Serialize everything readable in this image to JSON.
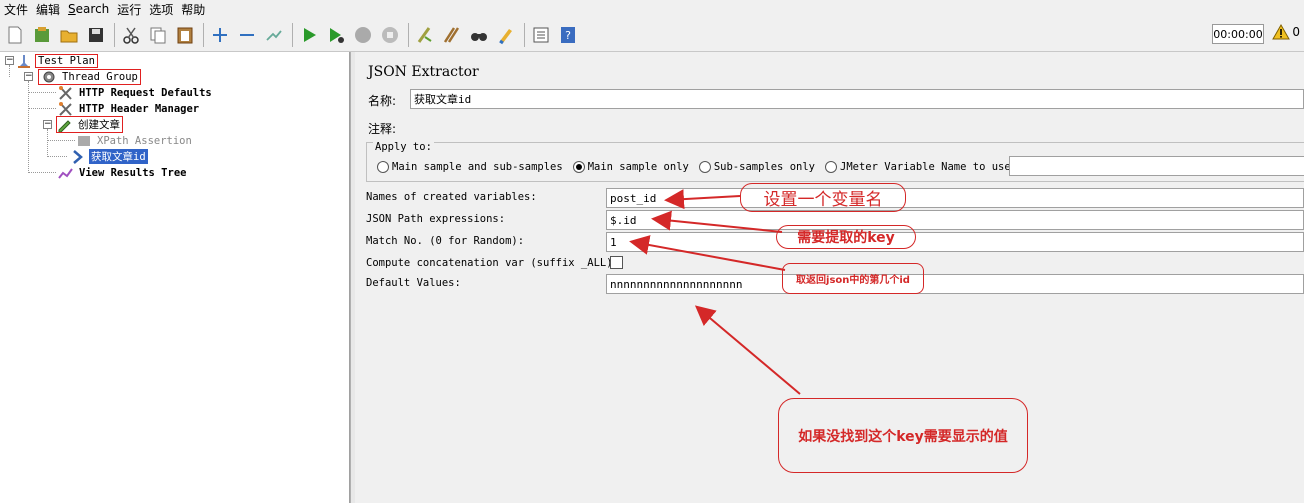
{
  "menu": [
    {
      "label": "文件"
    },
    {
      "label": "编辑"
    },
    {
      "label": "Search",
      "underline": "S"
    },
    {
      "label": "运行"
    },
    {
      "label": "选项"
    },
    {
      "label": "帮助"
    }
  ],
  "toolbar": {
    "timer": "00:00:00",
    "warn_count": "0"
  },
  "tree": {
    "test_plan": "Test Plan",
    "thread_group": "Thread Group",
    "http_defaults": "HTTP Request Defaults",
    "http_header": "HTTP Header Manager",
    "create_article": "创建文章",
    "xpath_assertion": "XPath Assertion",
    "get_article_id": "获取文章id",
    "view_results": "View Results Tree"
  },
  "panel": {
    "title": "JSON Extractor",
    "name_label": "名称:",
    "name_value": "获取文章id",
    "comment_label": "注释:",
    "comment_value": "",
    "apply_to": {
      "title": "Apply to:",
      "options": [
        {
          "label": "Main sample and sub-samples",
          "selected": false
        },
        {
          "label": "Main sample only",
          "selected": true
        },
        {
          "label": "Sub-samples only",
          "selected": false
        },
        {
          "label": "JMeter Variable Name to use",
          "selected": false
        }
      ],
      "variable_value": ""
    },
    "fields": {
      "names_label": "Names of created variables:",
      "names_value": "post_id",
      "path_label": "JSON Path expressions:",
      "path_value": "$.id",
      "match_label": "Match No. (0 for Random):",
      "match_value": "1",
      "concat_label": "Compute concatenation var (suffix _ALL):",
      "concat_checked": false,
      "default_label": "Default Values:",
      "default_value": "nnnnnnnnnnnnnnnnnnnn"
    }
  },
  "annotations": {
    "a1": "设置一个变量名",
    "a2": "需要提取的key",
    "a3": "取返回json中的第几个id",
    "a4": "如果没找到这个key需要显示的值"
  },
  "colors": {
    "annotation": "#d42828",
    "selection": "#3063c8"
  }
}
